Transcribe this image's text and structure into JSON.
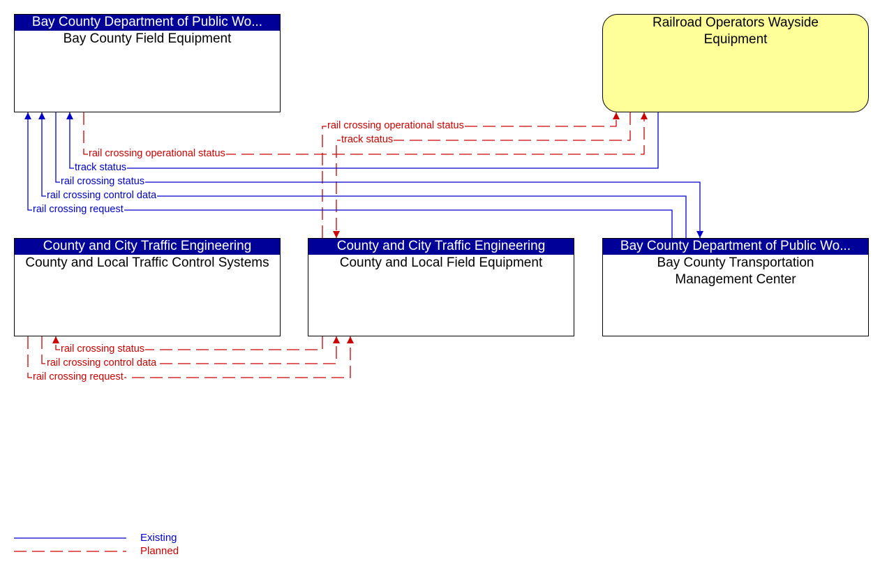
{
  "boxes": {
    "bay_field": {
      "header": "Bay County Department of Public Wo...",
      "title": "Bay County Field Equipment"
    },
    "wayside": {
      "title": "Railroad Operators Wayside Equipment"
    },
    "traffic_control": {
      "header": "County and City Traffic Engineering",
      "title": "County and Local Traffic Control Systems"
    },
    "local_field": {
      "header": "County and City Traffic Engineering",
      "title": "County and Local Field Equipment"
    },
    "tmc": {
      "header": "Bay County Department of Public Wo...",
      "title": "Bay County Transportation Management Center"
    }
  },
  "flows": [
    {
      "label": "rail crossing operational status",
      "status": "planned"
    },
    {
      "label": "track status",
      "status": "planned"
    },
    {
      "label": "rail crossing operational status",
      "status": "planned"
    },
    {
      "label": "track status",
      "status": "existing"
    },
    {
      "label": "rail crossing status",
      "status": "existing"
    },
    {
      "label": "rail crossing control data",
      "status": "existing"
    },
    {
      "label": "rail crossing request",
      "status": "existing"
    },
    {
      "label": "rail crossing status",
      "status": "planned"
    },
    {
      "label": "rail crossing control data",
      "status": "planned"
    },
    {
      "label": "rail crossing request",
      "status": "planned"
    }
  ],
  "legend": {
    "existing": "Existing",
    "planned": "Planned"
  },
  "colors": {
    "existing": "#0000cc",
    "planned": "#cc0000",
    "header": "#000099",
    "wayside_fill": "#ffff99"
  }
}
